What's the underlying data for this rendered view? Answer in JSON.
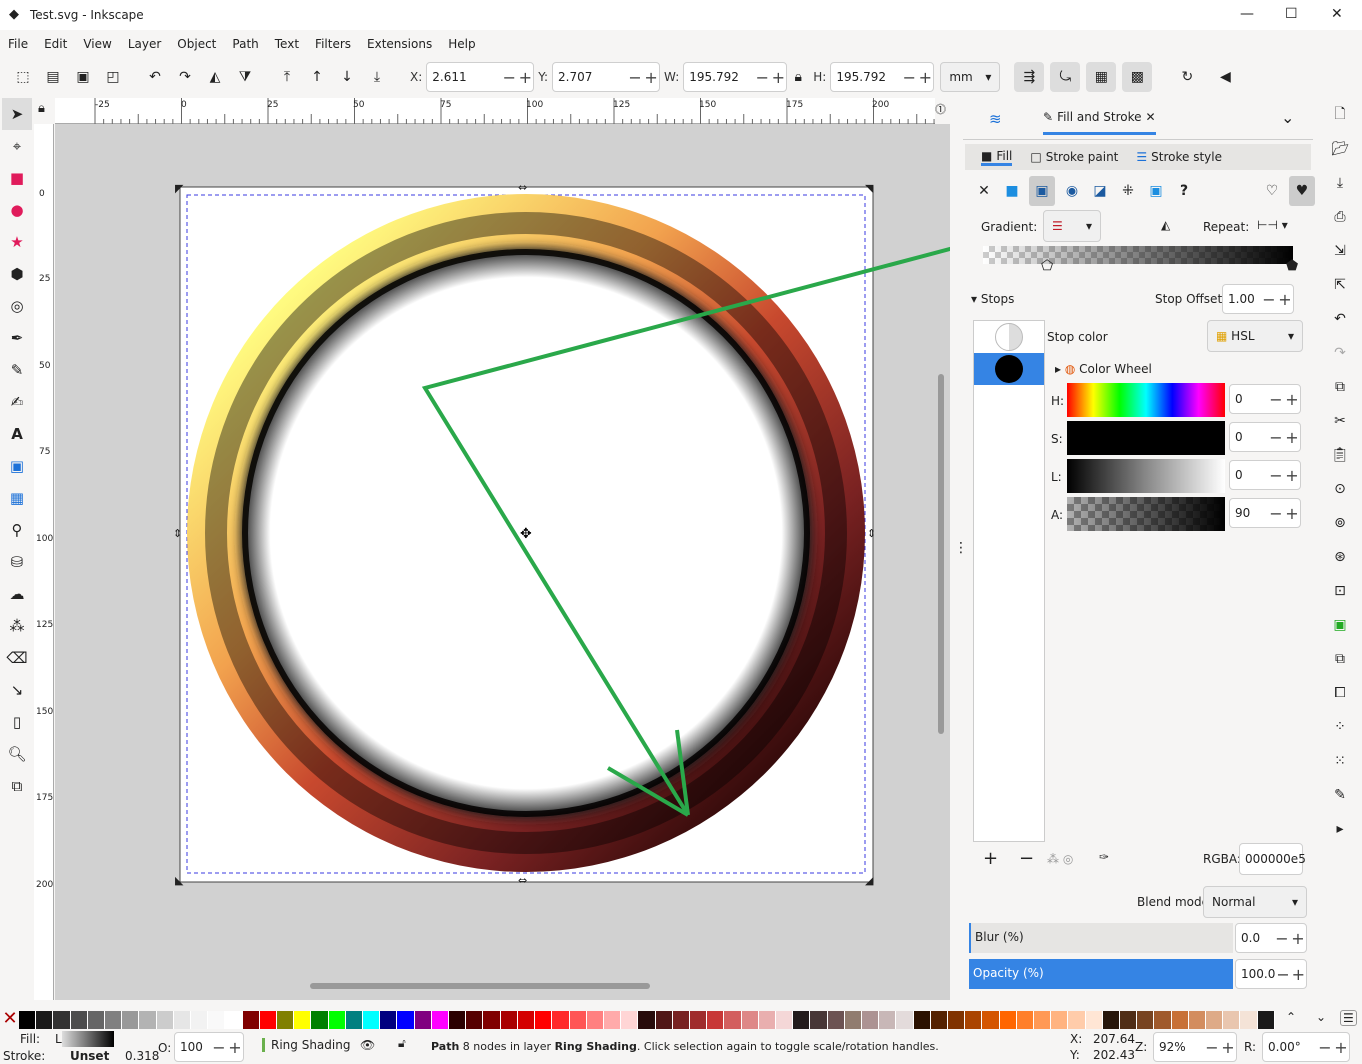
{
  "window": {
    "title": "Test.svg - Inkscape",
    "minimize": "—",
    "maximize": "☐",
    "close": "✕"
  },
  "menu": [
    "File",
    "Edit",
    "View",
    "Layer",
    "Object",
    "Path",
    "Text",
    "Filters",
    "Extensions",
    "Help"
  ],
  "toolbar": {
    "x_label": "X:",
    "x": "2.611",
    "y_label": "Y:",
    "y": "2.707",
    "w_label": "W:",
    "w": "195.792",
    "h_label": "H:",
    "h": "195.792",
    "unit": "mm"
  },
  "ruler": {
    "top": [
      "-25",
      "0",
      "25",
      "50",
      "75",
      "100",
      "125",
      "150",
      "175",
      "200"
    ],
    "left": [
      "0",
      "25",
      "50",
      "75",
      "100",
      "125",
      "150",
      "175",
      "200"
    ]
  },
  "panel": {
    "tab": "Fill and Stroke",
    "subtabs": [
      "Fill",
      "Stroke paint",
      "Stroke style"
    ],
    "gradient_label": "Gradient:",
    "repeat_label": "Repeat:",
    "stops_label": "Stops",
    "stop_offset_label": "Stop Offset:",
    "stop_offset": "1.00",
    "stop_color_label": "Stop color",
    "color_mode": "HSL",
    "color_wheel": "Color Wheel",
    "channels": [
      {
        "label": "H:",
        "value": "0"
      },
      {
        "label": "S:",
        "value": "0"
      },
      {
        "label": "L:",
        "value": "0"
      },
      {
        "label": "A:",
        "value": "90"
      }
    ],
    "rgba_label": "RGBA:",
    "rgba": "000000e5",
    "blend_label": "Blend mode:",
    "blend": "Normal",
    "blur_label": "Blur (%)",
    "blur": "0.0",
    "opacity_label": "Opacity (%)",
    "opacity": "100.0",
    "accent": "#3584e4"
  },
  "palette": [
    "#000000",
    "#1a1a1a",
    "#333333",
    "#4d4d4d",
    "#666666",
    "#808080",
    "#999999",
    "#b3b3b3",
    "#cccccc",
    "#e6e6e6",
    "#f2f2f2",
    "#f9f9f9",
    "#ffffff",
    "#800000",
    "#ff0000",
    "#808000",
    "#ffff00",
    "#008000",
    "#00ff00",
    "#008080",
    "#00ffff",
    "#000080",
    "#0000ff",
    "#800080",
    "#ff00ff",
    "#2b0000",
    "#550000",
    "#800000",
    "#aa0000",
    "#d40000",
    "#ff0000",
    "#ff2a2a",
    "#ff5555",
    "#ff8080",
    "#ffaaaa",
    "#ffd5d5",
    "#280b0b",
    "#501616",
    "#782121",
    "#a02c2c",
    "#c83737",
    "#d35f5f",
    "#de8787",
    "#e9afaf",
    "#f4d7d7",
    "#241c1c",
    "#483737",
    "#6c5353",
    "#917c6f",
    "#ac9393",
    "#c8b7b7",
    "#e3dbdb",
    "#2b1100",
    "#552200",
    "#803300",
    "#aa4400",
    "#d45500",
    "#ff6600",
    "#ff7f2a",
    "#ff9955",
    "#ffb380",
    "#ffccaa",
    "#ffe6d5",
    "#28170b",
    "#502d16",
    "#784421",
    "#a05a2c",
    "#c87137",
    "#d38d5f",
    "#deaa87",
    "#e9c6af",
    "#f4e3d7",
    "#1a1a1a"
  ],
  "status": {
    "fill_label": "Fill:",
    "fill_value": "L",
    "stroke_label": "Stroke:",
    "stroke_value": "Unset",
    "stroke_width": "0.318",
    "opacity_label": "O:",
    "opacity": "100",
    "layer": "Ring Shading",
    "message_bold1": "Path",
    "message1": " 8 nodes in layer ",
    "message_bold2": "Ring Shading",
    "message2": ". Click selection again to toggle scale/rotation handles.",
    "x_label": "X:",
    "x": "207.64",
    "y_label": "Y:",
    "y": "202.43",
    "zoom_label": "Z:",
    "zoom": "92%",
    "rot_label": "R:",
    "rotation": "0.00°"
  }
}
